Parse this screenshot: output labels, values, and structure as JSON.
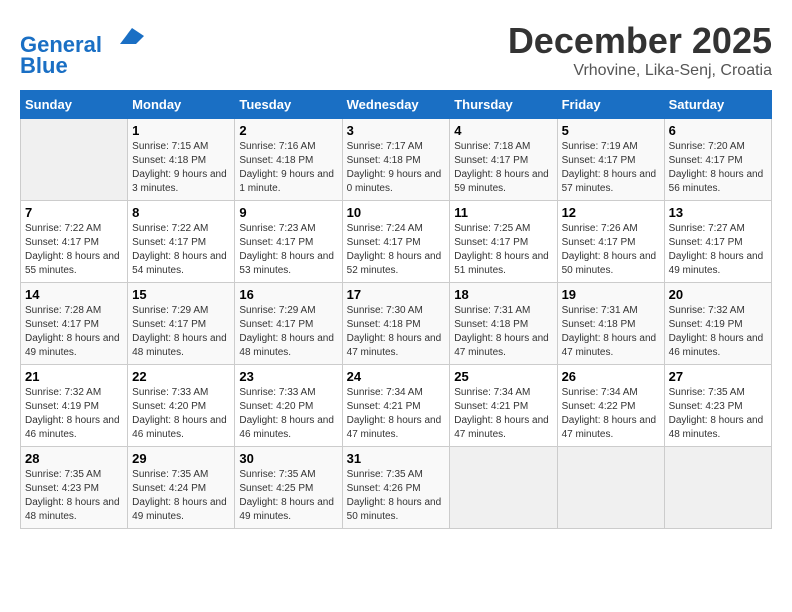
{
  "header": {
    "logo_line1": "General",
    "logo_line2": "Blue",
    "month": "December 2025",
    "location": "Vrhovine, Lika-Senj, Croatia"
  },
  "weekdays": [
    "Sunday",
    "Monday",
    "Tuesday",
    "Wednesday",
    "Thursday",
    "Friday",
    "Saturday"
  ],
  "weeks": [
    [
      {
        "day": "",
        "empty": true
      },
      {
        "day": "1",
        "sunrise": "7:15 AM",
        "sunset": "4:18 PM",
        "daylight": "9 hours and 3 minutes."
      },
      {
        "day": "2",
        "sunrise": "7:16 AM",
        "sunset": "4:18 PM",
        "daylight": "9 hours and 1 minute."
      },
      {
        "day": "3",
        "sunrise": "7:17 AM",
        "sunset": "4:18 PM",
        "daylight": "9 hours and 0 minutes."
      },
      {
        "day": "4",
        "sunrise": "7:18 AM",
        "sunset": "4:17 PM",
        "daylight": "8 hours and 59 minutes."
      },
      {
        "day": "5",
        "sunrise": "7:19 AM",
        "sunset": "4:17 PM",
        "daylight": "8 hours and 57 minutes."
      },
      {
        "day": "6",
        "sunrise": "7:20 AM",
        "sunset": "4:17 PM",
        "daylight": "8 hours and 56 minutes."
      }
    ],
    [
      {
        "day": "7",
        "sunrise": "7:22 AM",
        "sunset": "4:17 PM",
        "daylight": "8 hours and 55 minutes."
      },
      {
        "day": "8",
        "sunrise": "7:22 AM",
        "sunset": "4:17 PM",
        "daylight": "8 hours and 54 minutes."
      },
      {
        "day": "9",
        "sunrise": "7:23 AM",
        "sunset": "4:17 PM",
        "daylight": "8 hours and 53 minutes."
      },
      {
        "day": "10",
        "sunrise": "7:24 AM",
        "sunset": "4:17 PM",
        "daylight": "8 hours and 52 minutes."
      },
      {
        "day": "11",
        "sunrise": "7:25 AM",
        "sunset": "4:17 PM",
        "daylight": "8 hours and 51 minutes."
      },
      {
        "day": "12",
        "sunrise": "7:26 AM",
        "sunset": "4:17 PM",
        "daylight": "8 hours and 50 minutes."
      },
      {
        "day": "13",
        "sunrise": "7:27 AM",
        "sunset": "4:17 PM",
        "daylight": "8 hours and 49 minutes."
      }
    ],
    [
      {
        "day": "14",
        "sunrise": "7:28 AM",
        "sunset": "4:17 PM",
        "daylight": "8 hours and 49 minutes."
      },
      {
        "day": "15",
        "sunrise": "7:29 AM",
        "sunset": "4:17 PM",
        "daylight": "8 hours and 48 minutes."
      },
      {
        "day": "16",
        "sunrise": "7:29 AM",
        "sunset": "4:17 PM",
        "daylight": "8 hours and 48 minutes."
      },
      {
        "day": "17",
        "sunrise": "7:30 AM",
        "sunset": "4:18 PM",
        "daylight": "8 hours and 47 minutes."
      },
      {
        "day": "18",
        "sunrise": "7:31 AM",
        "sunset": "4:18 PM",
        "daylight": "8 hours and 47 minutes."
      },
      {
        "day": "19",
        "sunrise": "7:31 AM",
        "sunset": "4:18 PM",
        "daylight": "8 hours and 47 minutes."
      },
      {
        "day": "20",
        "sunrise": "7:32 AM",
        "sunset": "4:19 PM",
        "daylight": "8 hours and 46 minutes."
      }
    ],
    [
      {
        "day": "21",
        "sunrise": "7:32 AM",
        "sunset": "4:19 PM",
        "daylight": "8 hours and 46 minutes."
      },
      {
        "day": "22",
        "sunrise": "7:33 AM",
        "sunset": "4:20 PM",
        "daylight": "8 hours and 46 minutes."
      },
      {
        "day": "23",
        "sunrise": "7:33 AM",
        "sunset": "4:20 PM",
        "daylight": "8 hours and 46 minutes."
      },
      {
        "day": "24",
        "sunrise": "7:34 AM",
        "sunset": "4:21 PM",
        "daylight": "8 hours and 47 minutes."
      },
      {
        "day": "25",
        "sunrise": "7:34 AM",
        "sunset": "4:21 PM",
        "daylight": "8 hours and 47 minutes."
      },
      {
        "day": "26",
        "sunrise": "7:34 AM",
        "sunset": "4:22 PM",
        "daylight": "8 hours and 47 minutes."
      },
      {
        "day": "27",
        "sunrise": "7:35 AM",
        "sunset": "4:23 PM",
        "daylight": "8 hours and 48 minutes."
      }
    ],
    [
      {
        "day": "28",
        "sunrise": "7:35 AM",
        "sunset": "4:23 PM",
        "daylight": "8 hours and 48 minutes."
      },
      {
        "day": "29",
        "sunrise": "7:35 AM",
        "sunset": "4:24 PM",
        "daylight": "8 hours and 49 minutes."
      },
      {
        "day": "30",
        "sunrise": "7:35 AM",
        "sunset": "4:25 PM",
        "daylight": "8 hours and 49 minutes."
      },
      {
        "day": "31",
        "sunrise": "7:35 AM",
        "sunset": "4:26 PM",
        "daylight": "8 hours and 50 minutes."
      },
      {
        "day": "",
        "empty": true
      },
      {
        "day": "",
        "empty": true
      },
      {
        "day": "",
        "empty": true
      }
    ]
  ]
}
